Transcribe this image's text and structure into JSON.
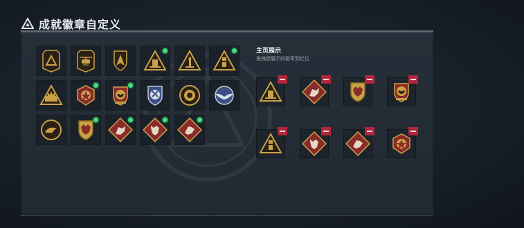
{
  "header": {
    "title": "成就徽章自定义",
    "icon": "triangle-warning-icon"
  },
  "colors": {
    "gold": "#c9a247",
    "dark": "#2a2015",
    "red": "#8a2a2a",
    "blue": "#3a4f86",
    "green_dot": "#3fe07a",
    "remove": "#b2273b"
  },
  "collection": {
    "badges": [
      {
        "icon": "triangle-outline-badge",
        "new": false
      },
      {
        "icon": "helicopter-badge",
        "new": false
      },
      {
        "icon": "arrowhead-shield-badge",
        "new": false
      },
      {
        "icon": "supply-triangle-badge",
        "new": true
      },
      {
        "icon": "number-one-triangle-badge",
        "new": false
      },
      {
        "icon": "tower-triangle-badge",
        "new": true
      },
      {
        "icon": "city-triangle-badge",
        "new": false
      },
      {
        "icon": "star-medal-badge",
        "new": true
      },
      {
        "icon": "eagle-crest-badge",
        "new": true
      },
      {
        "icon": "blue-shield-badge",
        "new": false
      },
      {
        "icon": "wreath-medallion-badge",
        "new": false
      },
      {
        "icon": "wings-blue-badge",
        "new": false
      },
      {
        "icon": "dolphin-circle-badge",
        "new": false
      },
      {
        "icon": "tiger-crest-badge",
        "new": true
      },
      {
        "icon": "beast-diamond-badge",
        "new": true
      },
      {
        "icon": "wolf-diamond-badge",
        "new": true
      },
      {
        "icon": "hound-diamond-badge",
        "new": true
      }
    ]
  },
  "display": {
    "title": "主页展示",
    "description": "拖拽想展示的徽章到栏位",
    "slots": [
      {
        "icon": "supply-triangle-badge"
      },
      {
        "icon": "beast-diamond-badge"
      },
      {
        "icon": "tiger-crest-badge"
      },
      {
        "icon": "eagle-crest-badge"
      },
      {
        "icon": "tower-triangle-badge"
      },
      {
        "icon": "wolf-diamond-badge"
      },
      {
        "icon": "hound-diamond-badge"
      },
      {
        "icon": "star-medal-badge"
      }
    ]
  }
}
